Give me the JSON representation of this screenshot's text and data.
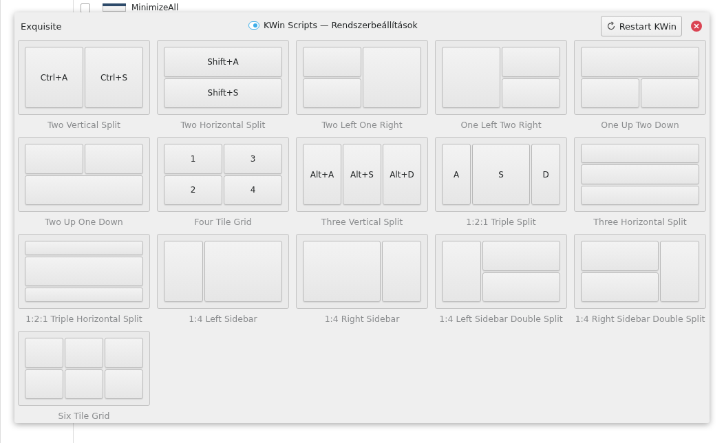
{
  "background": {
    "items": [
      {
        "title": "MinimizeAll",
        "checked": false
      }
    ]
  },
  "dialog": {
    "app_name": "Exquisite",
    "title": "KWin Scripts — Rendszerbeállítások",
    "restart_button": "Restart KWin"
  },
  "layouts": [
    {
      "kind": "two-vertical",
      "name": "Two Vertical Split",
      "keys": [
        "Ctrl+A",
        "Ctrl+S"
      ]
    },
    {
      "kind": "two-horizontal",
      "name": "Two Horizontal Split",
      "keys": [
        "Shift+A",
        "Shift+S"
      ]
    },
    {
      "kind": "two-left-one-right",
      "name": "Two Left One Right"
    },
    {
      "kind": "one-left-two-right",
      "name": "One Left Two Right"
    },
    {
      "kind": "one-up-two-down",
      "name": "One Up Two Down"
    },
    {
      "kind": "two-up-one-down",
      "name": "Two Up One Down"
    },
    {
      "kind": "four-grid",
      "name": "Four Tile Grid",
      "keys": [
        "1",
        "3",
        "2",
        "4"
      ]
    },
    {
      "kind": "three-vertical",
      "name": "Three Vertical Split",
      "keys": [
        "Alt+A",
        "Alt+S",
        "Alt+D"
      ]
    },
    {
      "kind": "triple-121",
      "name": "1:2:1 Triple Split",
      "keys": [
        "A",
        "S",
        "D"
      ]
    },
    {
      "kind": "three-horizontal",
      "name": "Three Horizontal Split"
    },
    {
      "kind": "triple-121-horizontal",
      "name": "1:2:1 Triple Horizontal Split"
    },
    {
      "kind": "left-sidebar",
      "name": "1:4 Left Sidebar"
    },
    {
      "kind": "right-sidebar",
      "name": "1:4 Right Sidebar"
    },
    {
      "kind": "left-sidebar-double",
      "name": "1:4 Left Sidebar Double Split"
    },
    {
      "kind": "right-sidebar-double",
      "name": "1:4 Right Sidebar Double Split"
    },
    {
      "kind": "six-grid",
      "name": "Six Tile Grid"
    }
  ]
}
